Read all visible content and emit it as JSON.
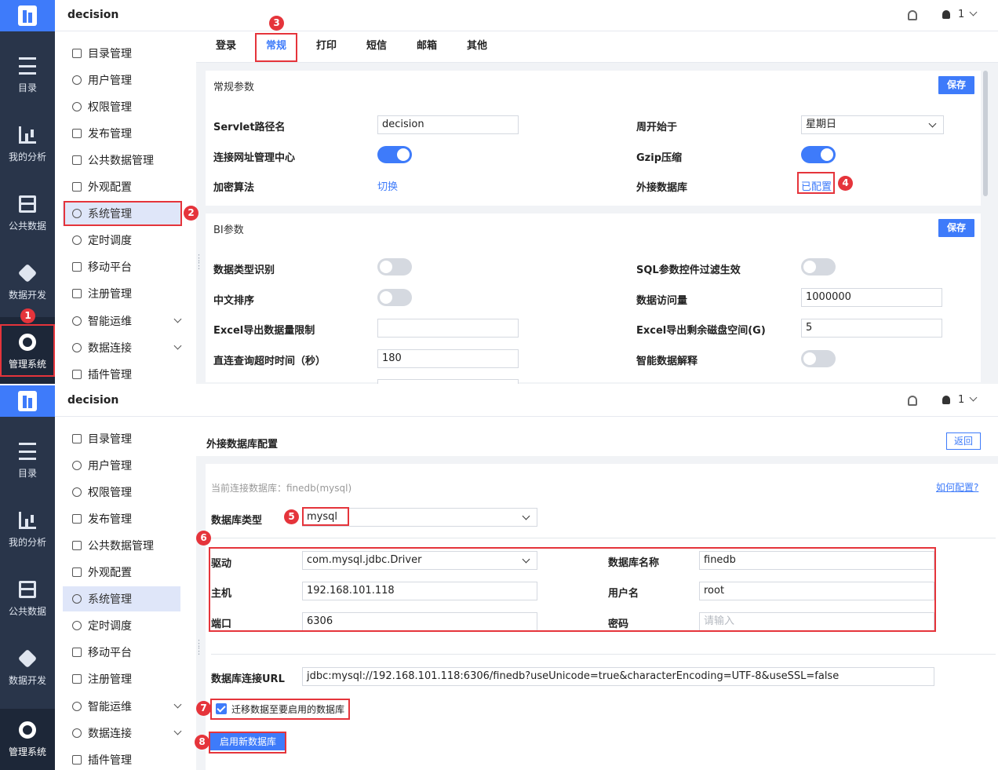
{
  "app": {
    "title": "decision",
    "user": "1"
  },
  "rail": [
    {
      "label": "目录",
      "icon": "list-icon"
    },
    {
      "label": "我的分析",
      "icon": "chart-icon"
    },
    {
      "label": "公共数据",
      "icon": "database-icon"
    },
    {
      "label": "数据开发",
      "icon": "cube-icon"
    },
    {
      "label": "管理系统",
      "icon": "gear-icon"
    }
  ],
  "menu": [
    {
      "label": "目录管理"
    },
    {
      "label": "用户管理"
    },
    {
      "label": "权限管理"
    },
    {
      "label": "发布管理"
    },
    {
      "label": "公共数据管理"
    },
    {
      "label": "外观配置"
    },
    {
      "label": "系统管理"
    },
    {
      "label": "定时调度"
    },
    {
      "label": "移动平台"
    },
    {
      "label": "注册管理"
    },
    {
      "label": "智能运维"
    },
    {
      "label": "数据连接"
    },
    {
      "label": "插件管理"
    }
  ],
  "tabs": [
    "登录",
    "常规",
    "打印",
    "短信",
    "邮箱",
    "其他"
  ],
  "general": {
    "title": "常规参数",
    "save": "保存",
    "servlet_label": "Servlet路径名",
    "servlet_value": "decision",
    "week_label": "周开始于",
    "week_value": "星期日",
    "connect_label": "连接网址管理中心",
    "gzip_label": "Gzip压缩",
    "encrypt_label": "加密算法",
    "encrypt_link": "切换",
    "extdb_label": "外接数据库",
    "extdb_link": "已配置"
  },
  "bi": {
    "title": "BI参数",
    "save": "保存",
    "type_detect_label": "数据类型识别",
    "sql_filter_label": "SQL参数控件过滤生效",
    "cn_sort_label": "中文排序",
    "access_label": "数据访问量",
    "access_value": "1000000",
    "excel_limit_label": "Excel导出数据量限制",
    "excel_limit_value": "",
    "excel_disk_label": "Excel导出剩余磁盘空间(G)",
    "excel_disk_value": "5",
    "timeout_label": "直连查询超时时间（秒）",
    "timeout_value": "180",
    "smart_label": "智能数据解释"
  },
  "extdb": {
    "title": "外接数据库配置",
    "return": "返回",
    "current": "当前连接数据库：finedb(mysql)",
    "howto": "如何配置?",
    "dbtype_label": "数据库类型",
    "dbtype_value": "mysql",
    "driver_label": "驱动",
    "driver_value": "com.mysql.jdbc.Driver",
    "dbname_label": "数据库名称",
    "dbname_value": "finedb",
    "host_label": "主机",
    "host_value": "192.168.101.118",
    "username_label": "用户名",
    "username_value": "root",
    "port_label": "端口",
    "port_value": "6306",
    "password_label": "密码",
    "password_placeholder": "请输入",
    "url_label": "数据库连接URL",
    "url_value": "jdbc:mysql://192.168.101.118:6306/finedb?useUnicode=true&characterEncoding=UTF-8&useSSL=false",
    "migrate_label": "迁移数据至要启用的数据库",
    "enable_button": "启用新数据库"
  },
  "markers": [
    "1",
    "2",
    "3",
    "4",
    "5",
    "6",
    "7",
    "8"
  ],
  "colors": {
    "rail": "#29354a",
    "accent": "#3e7bfa",
    "highlight": "#e5343b"
  }
}
